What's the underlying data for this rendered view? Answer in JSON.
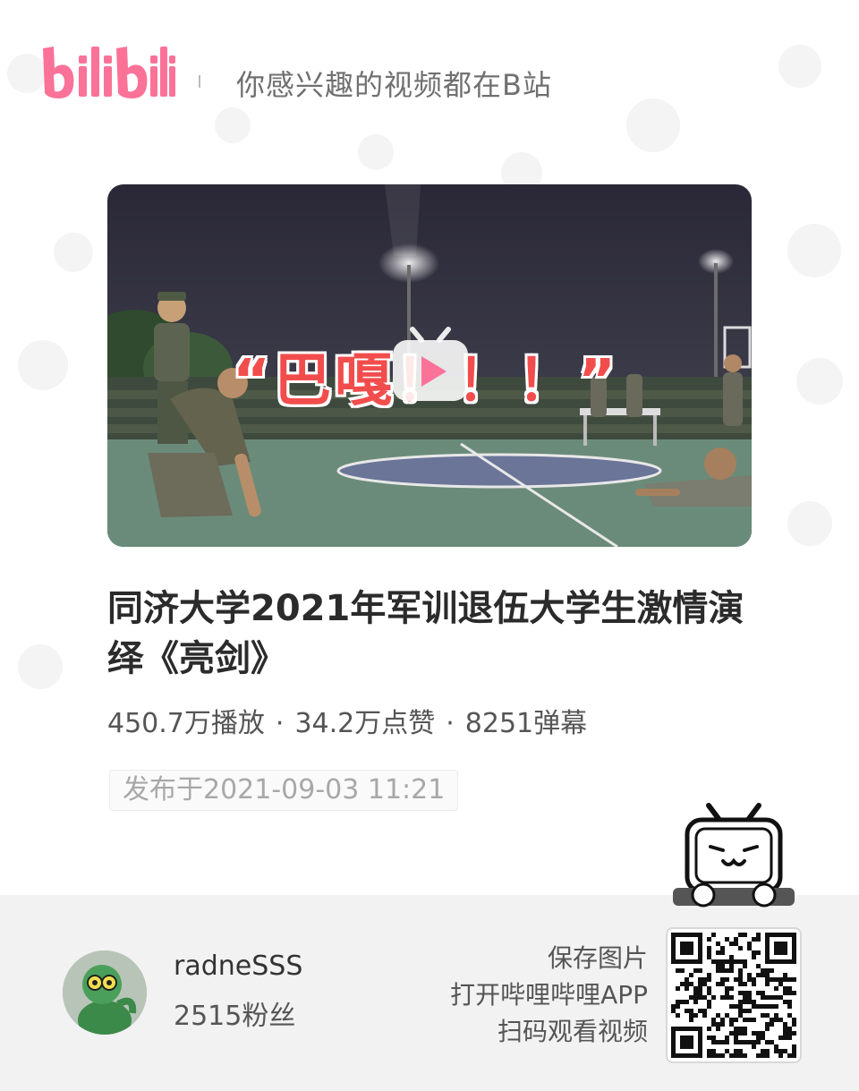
{
  "header": {
    "logo_text": "bilibili",
    "slogan": "你感兴趣的视频都在B站"
  },
  "video": {
    "cover_caption": "“巴嘎！！！”",
    "title": "同济大学2021年军训退伍大学生激情演绎《亮剑》",
    "stats": {
      "plays": "450.7万播放",
      "likes": "34.2万点赞",
      "danmaku": "8251弹幕",
      "separator": "·"
    },
    "published": "发布于2021-09-03 11:21"
  },
  "uploader": {
    "name": "radneSSS",
    "followers": "2515粉丝"
  },
  "cta": {
    "line1": "保存图片",
    "line2": "打开哔哩哔哩APP",
    "line3": "扫码观看视频"
  },
  "icons": {
    "logo": "bilibili-logo",
    "play": "tv-play-icon",
    "mascot": "bilibili-tv-mascot",
    "qr": "qr-code"
  },
  "colors": {
    "brand_pink": "#fb7299",
    "caption_red": "#f24d4d",
    "footer_bg": "#f2f2f2"
  }
}
